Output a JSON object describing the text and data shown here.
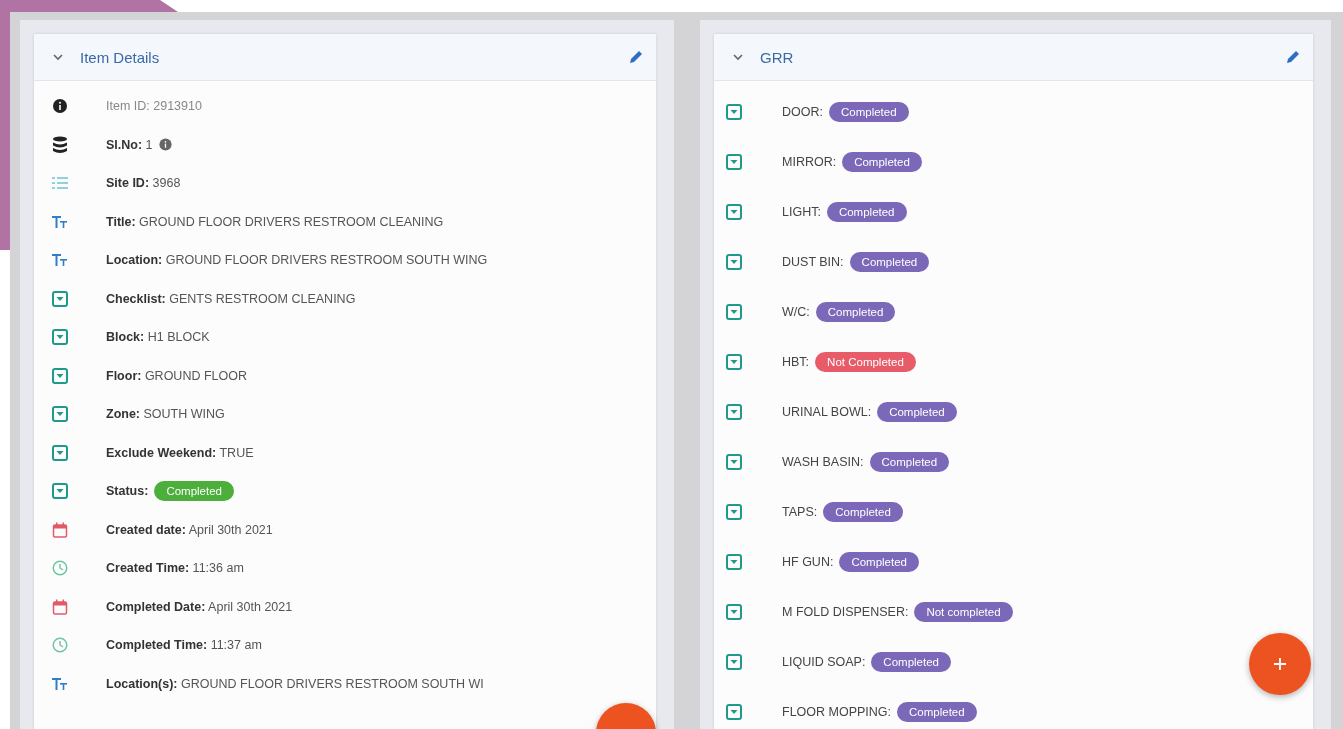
{
  "left_panel": {
    "title": "Item Details",
    "expanded": true,
    "rows": [
      {
        "kind": "info",
        "label": "Item ID:",
        "value": "2913910",
        "bold": false
      },
      {
        "kind": "database",
        "label": "Sl.No:",
        "value": "1",
        "bold": true,
        "info": true
      },
      {
        "kind": "list",
        "label": "Site ID:",
        "value": "3968",
        "bold": true
      },
      {
        "kind": "text",
        "label": "Title:",
        "value": "GROUND FLOOR DRIVERS RESTROOM CLEANING",
        "bold": true
      },
      {
        "kind": "text",
        "label": "Location:",
        "value": "GROUND FLOOR DRIVERS RESTROOM SOUTH WING",
        "bold": true
      },
      {
        "kind": "dropdown",
        "label": "Checklist:",
        "value": "GENTS RESTROOM CLEANING",
        "bold": true
      },
      {
        "kind": "dropdown",
        "label": "Block:",
        "value": "H1 BLOCK",
        "bold": true
      },
      {
        "kind": "dropdown",
        "label": "Floor:",
        "value": "GROUND FLOOR",
        "bold": true
      },
      {
        "kind": "dropdown",
        "label": "Zone:",
        "value": "SOUTH WING",
        "bold": true
      },
      {
        "kind": "dropdown",
        "label": "Exclude Weekend:",
        "value": "TRUE",
        "bold": true
      },
      {
        "kind": "dropdown",
        "label": "Status:",
        "badge": {
          "text": "Completed",
          "color": "#4caf3c"
        },
        "bold": true
      },
      {
        "kind": "calendar",
        "label": "Created date:",
        "value": "April 30th 2021",
        "bold": true
      },
      {
        "kind": "clock",
        "label": "Created Time:",
        "value": "11:36 am",
        "bold": true
      },
      {
        "kind": "calendar",
        "label": "Completed Date:",
        "value": "April 30th 2021",
        "bold": true
      },
      {
        "kind": "clock",
        "label": "Completed Time:",
        "value": "11:37 am",
        "bold": true
      },
      {
        "kind": "text",
        "label": "Location(s):",
        "value": "GROUND FLOOR DRIVERS RESTROOM SOUTH WI",
        "bold": true
      }
    ]
  },
  "right_panel": {
    "title": "GRR",
    "expanded": true,
    "rows": [
      {
        "label": "DOOR:",
        "badge": {
          "text": "Completed",
          "color": "#7b68b8"
        }
      },
      {
        "label": "MIRROR:",
        "badge": {
          "text": "Completed",
          "color": "#7b68b8"
        }
      },
      {
        "label": "LIGHT:",
        "badge": {
          "text": "Completed",
          "color": "#7b68b8"
        }
      },
      {
        "label": "DUST BIN:",
        "badge": {
          "text": "Completed",
          "color": "#7b68b8"
        }
      },
      {
        "label": "W/C:",
        "badge": {
          "text": "Completed",
          "color": "#7b68b8"
        }
      },
      {
        "label": "HBT:",
        "badge": {
          "text": "Not Completed",
          "color": "#e85c6a"
        }
      },
      {
        "label": "URINAL BOWL:",
        "badge": {
          "text": "Completed",
          "color": "#7b68b8"
        }
      },
      {
        "label": "WASH BASIN:",
        "badge": {
          "text": "Completed",
          "color": "#7b68b8"
        }
      },
      {
        "label": "TAPS:",
        "badge": {
          "text": "Completed",
          "color": "#7b68b8"
        }
      },
      {
        "label": "HF GUN:",
        "badge": {
          "text": "Completed",
          "color": "#7b68b8"
        }
      },
      {
        "label": "M FOLD DISPENSER:",
        "badge": {
          "text": "Not completed",
          "color": "#7b68b8"
        }
      },
      {
        "label": "LIQUID SOAP:",
        "badge": {
          "text": "Completed",
          "color": "#7b68b8"
        }
      },
      {
        "label": "FLOOR MOPPING:",
        "badge": {
          "text": "Completed",
          "color": "#7b68b8"
        }
      }
    ]
  }
}
